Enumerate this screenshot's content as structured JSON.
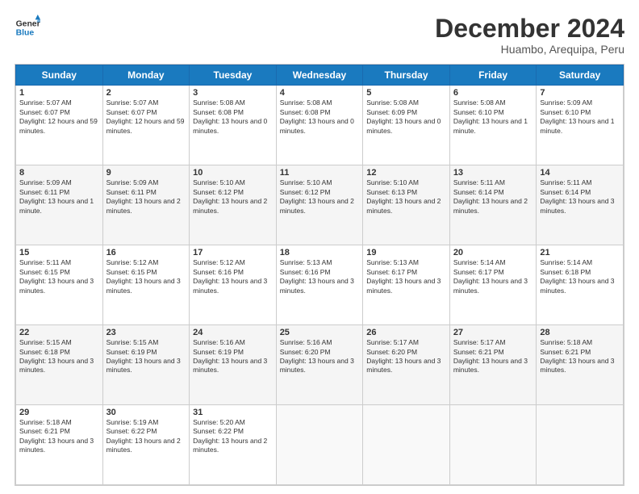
{
  "header": {
    "logo_line1": "General",
    "logo_line2": "Blue",
    "month": "December 2024",
    "location": "Huambo, Arequipa, Peru"
  },
  "weekdays": [
    "Sunday",
    "Monday",
    "Tuesday",
    "Wednesday",
    "Thursday",
    "Friday",
    "Saturday"
  ],
  "weeks": [
    [
      {
        "day": 1,
        "sunrise": "5:07 AM",
        "sunset": "6:07 PM",
        "daylight": "12 hours and 59 minutes."
      },
      {
        "day": 2,
        "sunrise": "5:07 AM",
        "sunset": "6:07 PM",
        "daylight": "12 hours and 59 minutes."
      },
      {
        "day": 3,
        "sunrise": "5:08 AM",
        "sunset": "6:08 PM",
        "daylight": "13 hours and 0 minutes."
      },
      {
        "day": 4,
        "sunrise": "5:08 AM",
        "sunset": "6:08 PM",
        "daylight": "13 hours and 0 minutes."
      },
      {
        "day": 5,
        "sunrise": "5:08 AM",
        "sunset": "6:09 PM",
        "daylight": "13 hours and 0 minutes."
      },
      {
        "day": 6,
        "sunrise": "5:08 AM",
        "sunset": "6:10 PM",
        "daylight": "13 hours and 1 minute."
      },
      {
        "day": 7,
        "sunrise": "5:09 AM",
        "sunset": "6:10 PM",
        "daylight": "13 hours and 1 minute."
      }
    ],
    [
      {
        "day": 8,
        "sunrise": "5:09 AM",
        "sunset": "6:11 PM",
        "daylight": "13 hours and 1 minute."
      },
      {
        "day": 9,
        "sunrise": "5:09 AM",
        "sunset": "6:11 PM",
        "daylight": "13 hours and 2 minutes."
      },
      {
        "day": 10,
        "sunrise": "5:10 AM",
        "sunset": "6:12 PM",
        "daylight": "13 hours and 2 minutes."
      },
      {
        "day": 11,
        "sunrise": "5:10 AM",
        "sunset": "6:12 PM",
        "daylight": "13 hours and 2 minutes."
      },
      {
        "day": 12,
        "sunrise": "5:10 AM",
        "sunset": "6:13 PM",
        "daylight": "13 hours and 2 minutes."
      },
      {
        "day": 13,
        "sunrise": "5:11 AM",
        "sunset": "6:14 PM",
        "daylight": "13 hours and 2 minutes."
      },
      {
        "day": 14,
        "sunrise": "5:11 AM",
        "sunset": "6:14 PM",
        "daylight": "13 hours and 3 minutes."
      }
    ],
    [
      {
        "day": 15,
        "sunrise": "5:11 AM",
        "sunset": "6:15 PM",
        "daylight": "13 hours and 3 minutes."
      },
      {
        "day": 16,
        "sunrise": "5:12 AM",
        "sunset": "6:15 PM",
        "daylight": "13 hours and 3 minutes."
      },
      {
        "day": 17,
        "sunrise": "5:12 AM",
        "sunset": "6:16 PM",
        "daylight": "13 hours and 3 minutes."
      },
      {
        "day": 18,
        "sunrise": "5:13 AM",
        "sunset": "6:16 PM",
        "daylight": "13 hours and 3 minutes."
      },
      {
        "day": 19,
        "sunrise": "5:13 AM",
        "sunset": "6:17 PM",
        "daylight": "13 hours and 3 minutes."
      },
      {
        "day": 20,
        "sunrise": "5:14 AM",
        "sunset": "6:17 PM",
        "daylight": "13 hours and 3 minutes."
      },
      {
        "day": 21,
        "sunrise": "5:14 AM",
        "sunset": "6:18 PM",
        "daylight": "13 hours and 3 minutes."
      }
    ],
    [
      {
        "day": 22,
        "sunrise": "5:15 AM",
        "sunset": "6:18 PM",
        "daylight": "13 hours and 3 minutes."
      },
      {
        "day": 23,
        "sunrise": "5:15 AM",
        "sunset": "6:19 PM",
        "daylight": "13 hours and 3 minutes."
      },
      {
        "day": 24,
        "sunrise": "5:16 AM",
        "sunset": "6:19 PM",
        "daylight": "13 hours and 3 minutes."
      },
      {
        "day": 25,
        "sunrise": "5:16 AM",
        "sunset": "6:20 PM",
        "daylight": "13 hours and 3 minutes."
      },
      {
        "day": 26,
        "sunrise": "5:17 AM",
        "sunset": "6:20 PM",
        "daylight": "13 hours and 3 minutes."
      },
      {
        "day": 27,
        "sunrise": "5:17 AM",
        "sunset": "6:21 PM",
        "daylight": "13 hours and 3 minutes."
      },
      {
        "day": 28,
        "sunrise": "5:18 AM",
        "sunset": "6:21 PM",
        "daylight": "13 hours and 3 minutes."
      }
    ],
    [
      {
        "day": 29,
        "sunrise": "5:18 AM",
        "sunset": "6:21 PM",
        "daylight": "13 hours and 3 minutes."
      },
      {
        "day": 30,
        "sunrise": "5:19 AM",
        "sunset": "6:22 PM",
        "daylight": "13 hours and 2 minutes."
      },
      {
        "day": 31,
        "sunrise": "5:20 AM",
        "sunset": "6:22 PM",
        "daylight": "13 hours and 2 minutes."
      },
      null,
      null,
      null,
      null
    ]
  ]
}
